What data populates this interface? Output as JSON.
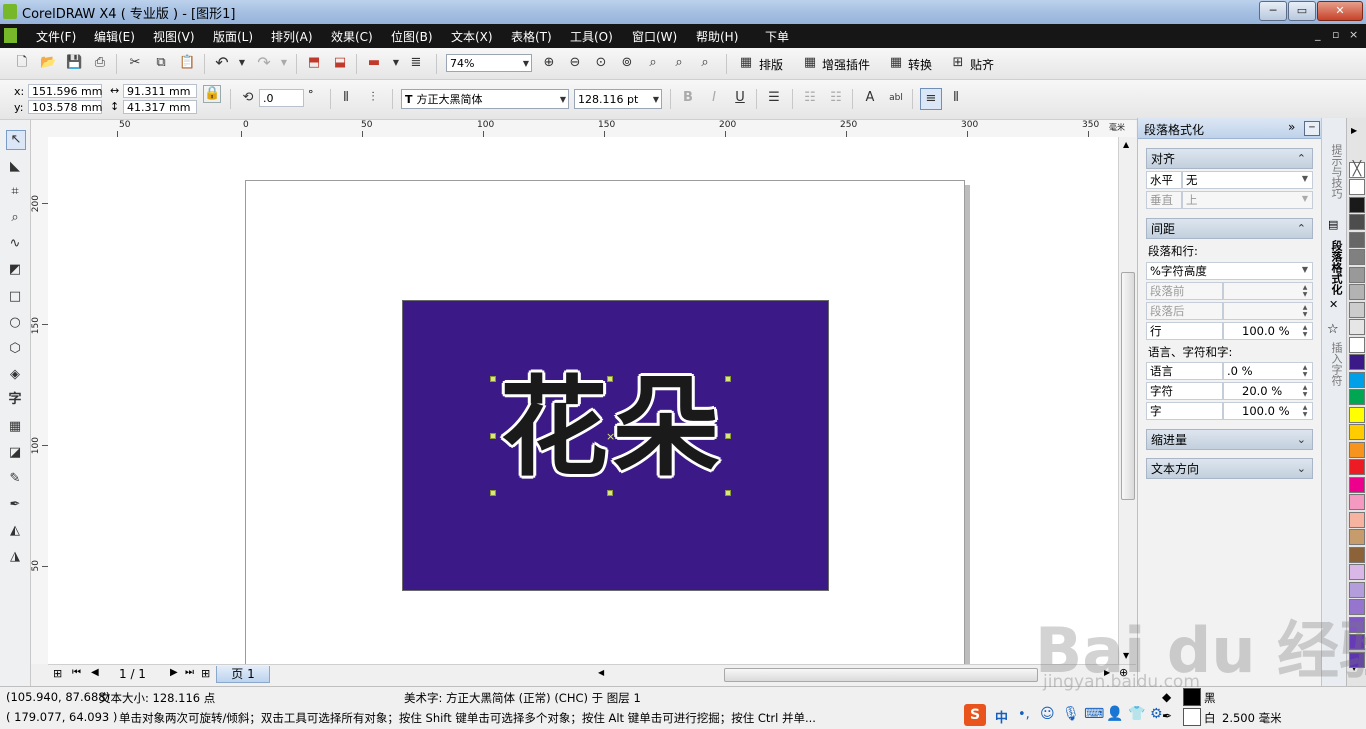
{
  "window": {
    "title": "CorelDRAW X4 ( 专业版 ) - [图形1]",
    "minimize": "─",
    "maximize": "▭",
    "close": "✕",
    "mdi_controls": [
      "_",
      "▫",
      "×"
    ]
  },
  "menu": [
    "文件(F)",
    "编辑(E)",
    "视图(V)",
    "版面(L)",
    "排列(A)",
    "效果(C)",
    "位图(B)",
    "文本(X)",
    "表格(T)",
    "工具(O)",
    "窗口(W)",
    "帮助(H)",
    "下单"
  ],
  "standard_toolbar": {
    "zoom": "74%",
    "buttons": [
      "排版",
      "增强插件",
      "转换",
      "贴齐"
    ]
  },
  "property_bar": {
    "x_label": "x:",
    "x": "151.596 mm",
    "y_label": "y:",
    "y": "103.578 mm",
    "width": "91.311 mm",
    "height": "41.317 mm",
    "angle": ".0",
    "angle_unit": "°",
    "font": "方正大黑简体",
    "font_size": "128.116 pt"
  },
  "rulers": {
    "h_labels": [
      "50",
      "0",
      "50",
      "100",
      "150",
      "200",
      "250",
      "300",
      "350"
    ],
    "h_unit": "毫米",
    "v_labels": [
      "200",
      "150",
      "100",
      "50"
    ]
  },
  "canvas": {
    "text": "花朵",
    "rect_color": "#3b1a87"
  },
  "page_nav": {
    "counter": "1 / 1",
    "tab": "页 1"
  },
  "docker": {
    "title": "段落格式化",
    "sections": {
      "align": {
        "title": "对齐",
        "h_label": "水平",
        "h_value": "无",
        "v_label": "垂直",
        "v_value": "上"
      },
      "spacing": {
        "title": "间距",
        "para_label": "段落和行:",
        "unit": "%字符高度",
        "before": "段落前",
        "after": "段落后",
        "line_label": "行",
        "line_value": "100.0 %",
        "lang_label": "语言、字符和字:",
        "lang": "语言",
        "lang_value": ".0 %",
        "char": "字符",
        "char_value": "20.0 %",
        "word": "字",
        "word_value": "100.0 %"
      },
      "indent": {
        "title": "缩进量"
      },
      "direction": {
        "title": "文本方向"
      }
    }
  },
  "side_tabs": [
    "提示与技巧",
    "段落格式化",
    "插入字符"
  ],
  "palette": [
    "#ffffff",
    "#1a1a1a",
    "#4d4d4d",
    "#666666",
    "#808080",
    "#999999",
    "#b3b3b3",
    "#cccccc",
    "#e6e6e6",
    "#ffffff",
    "#3b1a87",
    "#00a0e9",
    "#00a651",
    "#ffff00",
    "#ffcc00",
    "#f7941d",
    "#ed1c24",
    "#ec008c",
    "#f49ac1",
    "#f6b3a0",
    "#c69c6d",
    "#8c6239",
    "#d9b8e8",
    "#b39ddb",
    "#9575cd",
    "#7e57c2",
    "#673ab7",
    "#5e35b1"
  ],
  "status": {
    "coords": "(105.940, 87.688)",
    "size": "文本大小: 128.116 点",
    "info": "美术字: 方正大黑简体 (正常) (CHC) 于 图层 1",
    "cursor": "( 179.077, 64.093 )",
    "hint": "单击对象两次可旋转/倾斜；双击工具可选择所有对象；按住 Shift 键单击可选择多个对象；按住 Alt 键单击可进行挖掘；按住 Ctrl 并单...",
    "fill_label": "黑",
    "outline_label": "白",
    "outline_width": "2.500 毫米",
    "ime": "中"
  },
  "watermark": {
    "logo": "Bai du 经验",
    "url": "jingyan.baidu.com"
  }
}
